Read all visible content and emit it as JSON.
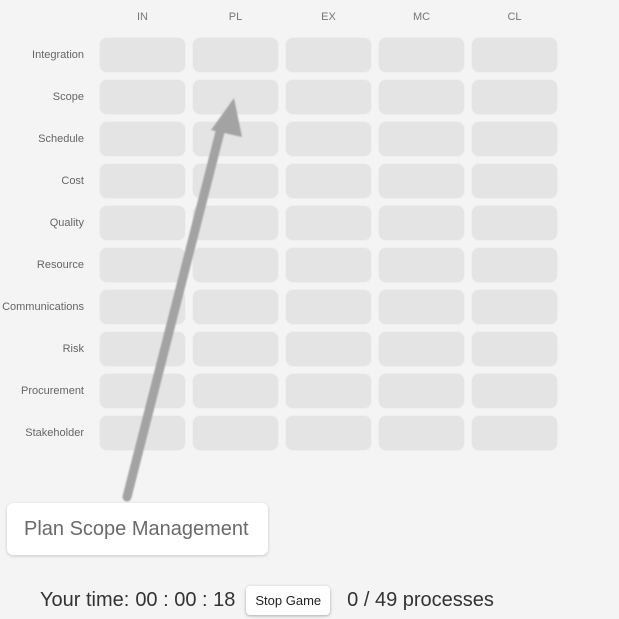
{
  "columns": [
    "IN",
    "PL",
    "EX",
    "MC",
    "CL"
  ],
  "rows": [
    "Integration",
    "Scope",
    "Schedule",
    "Cost",
    "Quality",
    "Resource",
    "Communications",
    "Risk",
    "Procurement",
    "Stakeholder"
  ],
  "current_card": "Plan Scope Management",
  "drag_hint": {
    "from": "current-card",
    "to_row": "Scope",
    "to_column": "PL"
  },
  "footer": {
    "time_label": "Your time:",
    "time_value": "00 : 00 : 18",
    "stop_button": "Stop Game",
    "progress_text": "0 / 49 processes",
    "placed": 0,
    "total": 49
  },
  "colors": {
    "background": "#f4f4f4",
    "cell": "#e4e4e4",
    "arrow": "#a3a3a3",
    "card": "#ffffff"
  }
}
